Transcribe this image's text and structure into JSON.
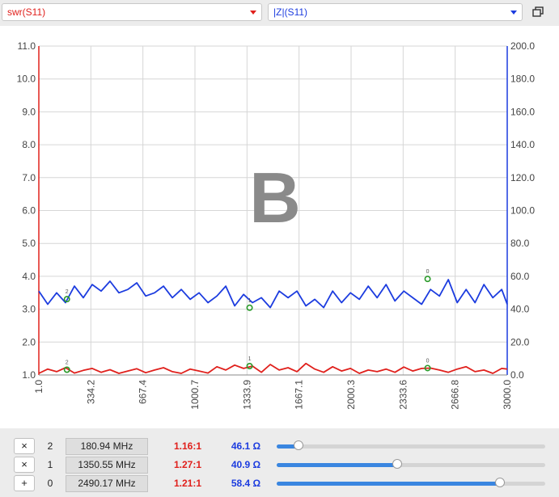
{
  "toolbar": {
    "left_trace": {
      "label": "swr(S11)",
      "color": "#e0201c"
    },
    "right_trace": {
      "label": "|Z|(S11)",
      "color": "#1c3cdf"
    },
    "restore_icon": "restore-window-icon"
  },
  "watermark": "B",
  "chart_data": {
    "type": "line",
    "title": "",
    "xlabel": "",
    "x_ticks": [
      "1.0",
      "334.2",
      "667.4",
      "1000.7",
      "1333.9",
      "1667.1",
      "2000.3",
      "2333.6",
      "2666.8",
      "3000.0"
    ],
    "xlim": [
      1.0,
      3000.0
    ],
    "left_axis": {
      "ylim": [
        1.0,
        11.0
      ],
      "ticks": [
        "1.0",
        "2.0",
        "3.0",
        "4.0",
        "5.0",
        "6.0",
        "7.0",
        "8.0",
        "9.0",
        "10.0",
        "11.0"
      ],
      "color": "#e0201c"
    },
    "right_axis": {
      "ylim": [
        0.0,
        200.0
      ],
      "ticks": [
        "0.0",
        "20.0",
        "40.0",
        "60.0",
        "80.0",
        "100.0",
        "120.0",
        "140.0",
        "160.0",
        "180.0",
        "200.0"
      ],
      "color": "#1c3cdf"
    },
    "x": [
      1,
      58,
      115,
      172,
      229,
      286,
      343,
      400,
      457,
      514,
      571,
      628,
      685,
      742,
      799,
      856,
      913,
      970,
      1027,
      1084,
      1141,
      1198,
      1255,
      1312,
      1369,
      1426,
      1483,
      1540,
      1597,
      1654,
      1711,
      1768,
      1825,
      1882,
      1939,
      1996,
      2053,
      2110,
      2167,
      2224,
      2281,
      2338,
      2395,
      2452,
      2509,
      2566,
      2623,
      2680,
      2737,
      2794,
      2851,
      2908,
      2965,
      3000
    ],
    "series": [
      {
        "name": "swr(S11)",
        "axis": "left",
        "color": "#e0201c",
        "values": [
          1.05,
          1.18,
          1.1,
          1.22,
          1.06,
          1.14,
          1.2,
          1.08,
          1.16,
          1.05,
          1.12,
          1.19,
          1.07,
          1.15,
          1.22,
          1.1,
          1.05,
          1.18,
          1.12,
          1.06,
          1.25,
          1.15,
          1.3,
          1.2,
          1.27,
          1.08,
          1.32,
          1.15,
          1.22,
          1.1,
          1.35,
          1.18,
          1.08,
          1.25,
          1.12,
          1.2,
          1.05,
          1.15,
          1.1,
          1.18,
          1.08,
          1.24,
          1.12,
          1.2,
          1.21,
          1.15,
          1.08,
          1.18,
          1.25,
          1.1,
          1.15,
          1.05,
          1.2,
          1.18
        ]
      },
      {
        "name": "|Z|(S11)",
        "axis": "right",
        "color": "#1c3cdf",
        "values": [
          51,
          43,
          50,
          44,
          54,
          47,
          55,
          51,
          57,
          50,
          52,
          56,
          48,
          50,
          54,
          47,
          52,
          46,
          50,
          44,
          48,
          54,
          42,
          49,
          44,
          47,
          41,
          51,
          47,
          51,
          42,
          46,
          41,
          51,
          44,
          50,
          46,
          54,
          47,
          55,
          45,
          51,
          47,
          43,
          52,
          48,
          58,
          44,
          52,
          44,
          55,
          47,
          52,
          43
        ]
      }
    ],
    "markers": [
      {
        "label": "2",
        "x": 180.94,
        "swr": 1.16,
        "z": 46.1,
        "color": "#2a9a2a"
      },
      {
        "label": "1",
        "x": 1350.55,
        "swr": 1.27,
        "z": 40.9,
        "color": "#2a9a2a"
      },
      {
        "label": "0",
        "x": 2490.17,
        "swr": 1.21,
        "z": 58.4,
        "color": "#2a9a2a"
      }
    ],
    "grid": true
  },
  "marker_rows": [
    {
      "button": "×",
      "index": "2",
      "freq": "180.94 MHz",
      "swr": "1.16:1",
      "impedance": "46.1 Ω",
      "slider": 0.08
    },
    {
      "button": "×",
      "index": "1",
      "freq": "1350.55 MHz",
      "swr": "1.27:1",
      "impedance": "40.9 Ω",
      "slider": 0.45
    },
    {
      "button": "+",
      "index": "0",
      "freq": "2490.17 MHz",
      "swr": "1.21:1",
      "impedance": "58.4 Ω",
      "slider": 0.83
    }
  ]
}
